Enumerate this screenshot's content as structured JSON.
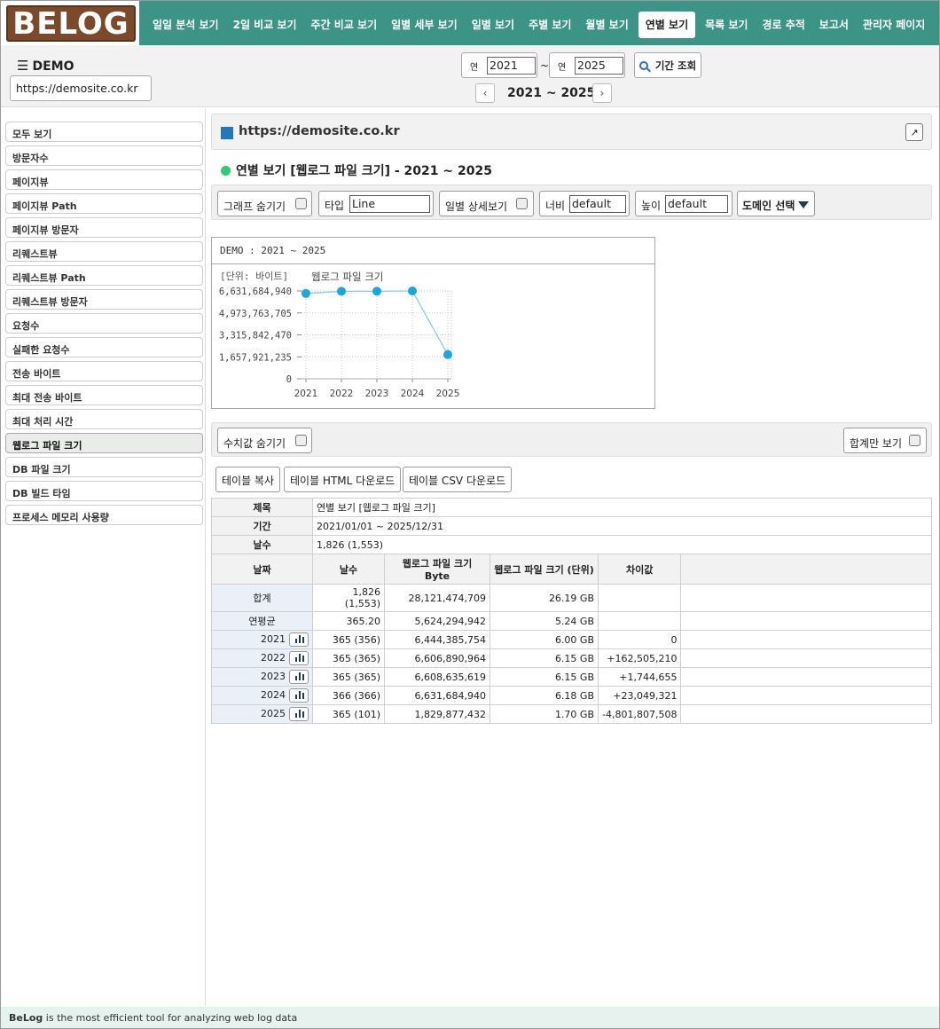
{
  "app": {
    "logo": "BELOG"
  },
  "nav": {
    "items": [
      "일일 분석 보기",
      "2일 비교 보기",
      "주간 비교 보기",
      "일별 세부 보기",
      "일별 보기",
      "주별 보기",
      "월별 보기",
      "연별 보기",
      "목록 보기",
      "경로 추적",
      "보고서",
      "관리자 페이지"
    ],
    "active": "연별 보기"
  },
  "header": {
    "demo_label": "DEMO",
    "site": "https://demosite.co.kr",
    "from_label": "연",
    "from_value": "2021",
    "tilde": "~",
    "to_label": "연",
    "to_value": "2025",
    "query_button": "기간 조회",
    "range_label": "2021 ~ 2025",
    "prev_icon": "chevron-left-icon",
    "next_icon": "chevron-right-icon"
  },
  "sidebar": {
    "items": [
      "모두 보기",
      "방문자수",
      "페이지뷰",
      "페이지뷰 Path",
      "페이지뷰 방문자",
      "리퀘스트뷰",
      "리퀘스트뷰 Path",
      "리퀘스트뷰 방문자",
      "요청수",
      "실패한 요청수",
      "전송 바이트",
      "최대 전송 바이트",
      "최대 처리 시간",
      "웹로그 파일 크기",
      "DB 파일 크기",
      "DB 빌드 타임",
      "프로세스 메모리 사용량"
    ],
    "active": "웹로그 파일 크기"
  },
  "main": {
    "url": "https://demosite.co.kr",
    "section_title": "연별 보기 [웹로그 파일 크기] - 2021 ~ 2025",
    "toolbar": {
      "hide_graph": "그래프 숨기기",
      "type_label": "타입",
      "type_value": "Line",
      "daily_detail": "일별 상세보기",
      "width_label": "너비",
      "width_value": "default",
      "height_label": "높이",
      "height_value": "default",
      "domain_select": "도메인 선택"
    },
    "hide_values": "수치값 숨기기",
    "sum_only": "합계만 보기",
    "copy_buttons": [
      "테이블 복사",
      "테이블 HTML 다운로드",
      "테이블 CSV 다운로드"
    ]
  },
  "chart_data": {
    "type": "line",
    "title": "DEMO : 2021 ~ 2025",
    "unit_label": "[단위: 바이트]",
    "series_name": "웹로그 파일 크기",
    "categories": [
      "2021",
      "2022",
      "2023",
      "2024",
      "2025"
    ],
    "values": [
      6444385754,
      6606890964,
      6608635619,
      6631684940,
      1829877432
    ],
    "y_ticks": [
      "6,631,684,940",
      "4,973,763,705",
      "3,315,842,470",
      "1,657,921,235",
      "0"
    ],
    "ylim": [
      0,
      6631684940
    ],
    "grid": true,
    "colors": {
      "line": "#89cdea",
      "point": "#1aa7de"
    }
  },
  "table": {
    "meta": [
      {
        "label": "제목",
        "value": "연별 보기 [웹로그 파일 크기]"
      },
      {
        "label": "기간",
        "value": "2021/01/01 ~ 2025/12/31"
      },
      {
        "label": "날수",
        "value": "1,826 (1,553)"
      }
    ],
    "headers": [
      "날짜",
      "날수",
      "웹로그 파일 크기 Byte",
      "웹로그 파일 크기 (단위)",
      "차이값"
    ],
    "rows": [
      {
        "label": "합계",
        "days": "1,826 (1,553)",
        "bytes": "28,121,474,709",
        "unit": "26.19 GB",
        "diff": ""
      },
      {
        "label": "연평균",
        "days": "365.20",
        "bytes": "5,624,294,942",
        "unit": "5.24 GB",
        "diff": ""
      },
      {
        "label": "2021",
        "days": "365 (356)",
        "bytes": "6,444,385,754",
        "unit": "6.00 GB",
        "diff": "0"
      },
      {
        "label": "2022",
        "days": "365 (365)",
        "bytes": "6,606,890,964",
        "unit": "6.15 GB",
        "diff": "+162,505,210"
      },
      {
        "label": "2023",
        "days": "365 (365)",
        "bytes": "6,608,635,619",
        "unit": "6.15 GB",
        "diff": "+1,744,655"
      },
      {
        "label": "2024",
        "days": "366 (366)",
        "bytes": "6,631,684,940",
        "unit": "6.18 GB",
        "diff": "+23,049,321"
      },
      {
        "label": "2025",
        "days": "365 (101)",
        "bytes": "1,829,877,432",
        "unit": "1.70 GB",
        "diff": "-4,801,807,508"
      }
    ]
  },
  "footer": {
    "brand": "BeLog",
    "text": " is the most efficient tool for analyzing web log data"
  }
}
